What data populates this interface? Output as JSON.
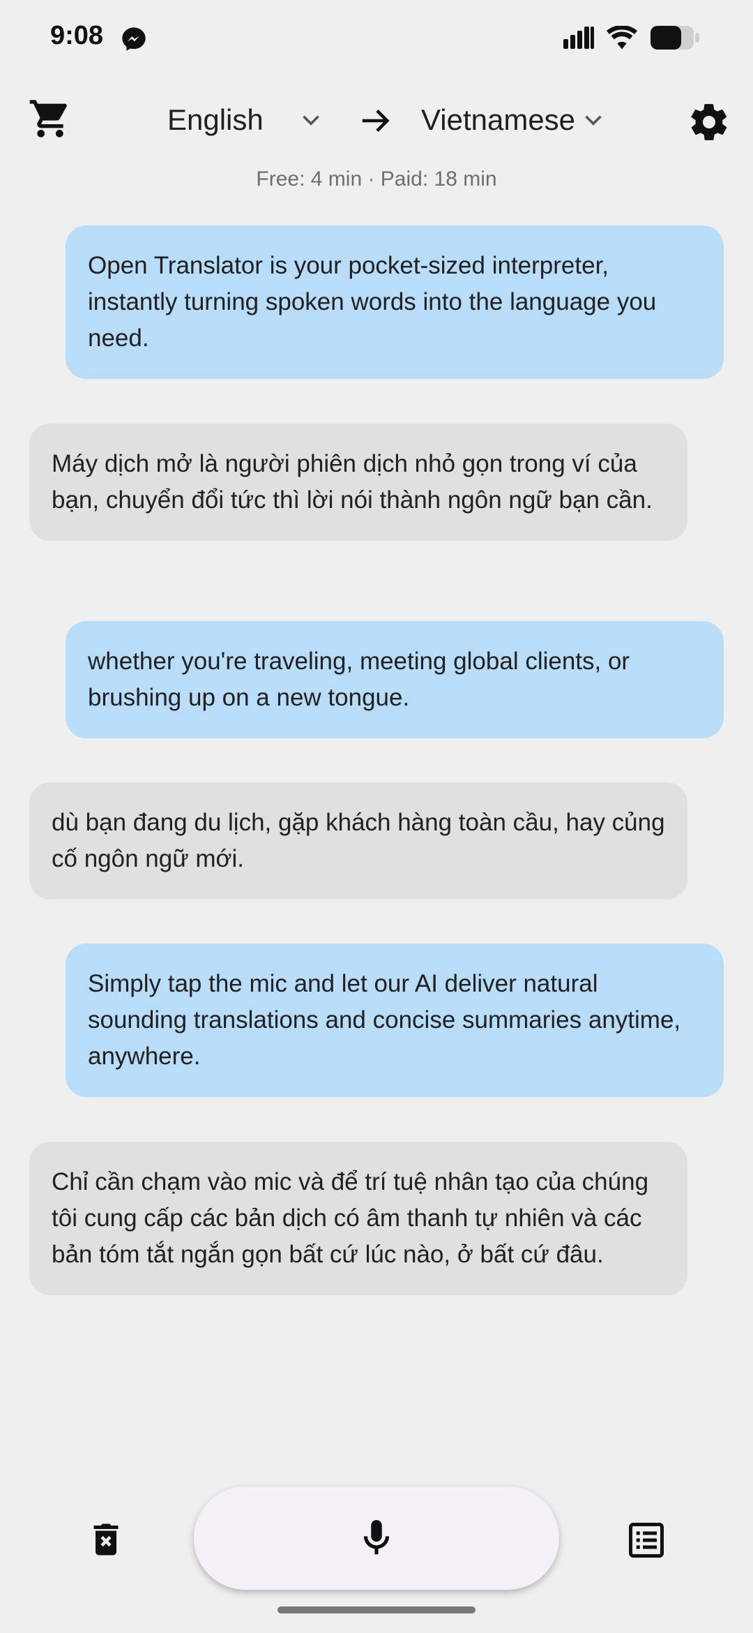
{
  "status_bar": {
    "time": "9:08",
    "icons": [
      "messenger-icon",
      "signal-icon",
      "wifi-icon",
      "battery-icon"
    ]
  },
  "top_bar": {
    "cart_icon": "cart-icon",
    "source_language": "English",
    "target_language": "Vietnamese",
    "settings_icon": "gear-icon"
  },
  "usage_text": "Free: 4 min · Paid: 18 min",
  "conversation": [
    {
      "role": "source",
      "text": "Open Translator is your pocket-sized interpreter, instantly turning spoken words into the language you need."
    },
    {
      "role": "translation",
      "text": "Máy dịch mở là người phiên dịch nhỏ gọn trong ví của bạn, chuyển đổi tức thì lời nói thành ngôn ngữ bạn cần."
    },
    {
      "role": "source",
      "text": "whether you're traveling, meeting global clients, or brushing up on a new tongue."
    },
    {
      "role": "translation",
      "text": "dù bạn đang du lịch, gặp khách hàng toàn cầu, hay củng cố ngôn ngữ mới."
    },
    {
      "role": "source",
      "text": "Simply tap the mic and let our AI deliver natural sounding translations and concise summaries anytime, anywhere."
    },
    {
      "role": "translation",
      "text": "Chỉ cần chạm vào mic và để trí tuệ nhân tạo của chúng tôi cung cấp các bản dịch có âm thanh tự nhiên và các bản tóm tắt ngắn gọn bất cứ lúc nào, ở bất cứ đâu."
    }
  ],
  "bottom_bar": {
    "delete_icon": "delete-icon",
    "mic_icon": "mic-icon",
    "summary_icon": "list-icon"
  },
  "colors": {
    "background": "#efefef",
    "source_bubble": "#b9dcf8",
    "translation_bubble": "#e0e0e0",
    "mic_button": "#f5f0f8"
  }
}
